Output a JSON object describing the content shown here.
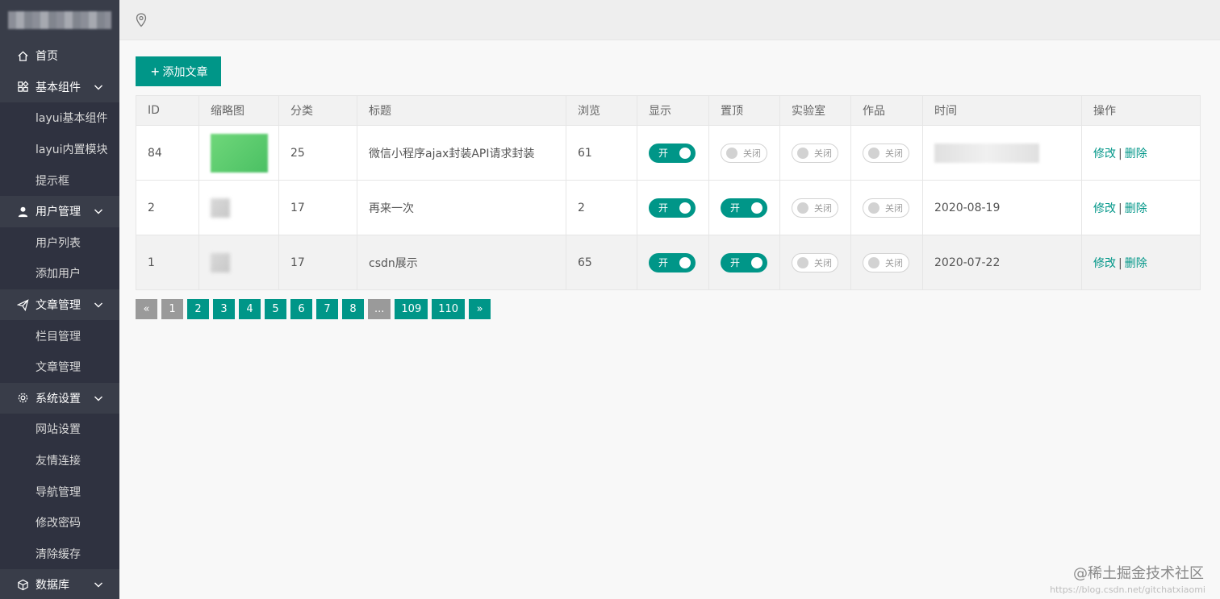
{
  "sidebar": {
    "items": [
      {
        "label": "首页",
        "icon": "home-icon",
        "sub": []
      },
      {
        "label": "基本组件",
        "icon": "grid-icon",
        "sub": [
          "layui基本组件",
          "layui内置模块",
          "提示框"
        ]
      },
      {
        "label": "用户管理",
        "icon": "user-icon",
        "sub": [
          "用户列表",
          "添加用户"
        ]
      },
      {
        "label": "文章管理",
        "icon": "send-icon",
        "sub": [
          "栏目管理",
          "文章管理"
        ]
      },
      {
        "label": "系统设置",
        "icon": "gear-icon",
        "sub": [
          "网站设置",
          "友情连接",
          "导航管理",
          "修改密码",
          "清除缓存"
        ]
      },
      {
        "label": "数据库",
        "icon": "cube-icon",
        "sub": []
      }
    ]
  },
  "header": {
    "location_icon": "location-pin-icon"
  },
  "toolbar": {
    "add_label": "添加文章"
  },
  "table": {
    "headers": [
      "ID",
      "缩略图",
      "分类",
      "标题",
      "浏览",
      "显示",
      "置顶",
      "实验室",
      "作品",
      "时间",
      "操作"
    ],
    "rows": [
      {
        "id": "84",
        "category": "25",
        "title": "微信小程序ajax封装API请求封装",
        "views": "61",
        "show": true,
        "top": false,
        "lab": false,
        "work": false,
        "time": ""
      },
      {
        "id": "2",
        "category": "17",
        "title": "再来一次",
        "views": "2",
        "show": true,
        "top": true,
        "lab": false,
        "work": false,
        "time": "2020-08-19"
      },
      {
        "id": "1",
        "category": "17",
        "title": "csdn展示",
        "views": "65",
        "show": true,
        "top": true,
        "lab": false,
        "work": false,
        "time": "2020-07-22"
      }
    ],
    "switch_on_label": "开",
    "switch_off_label": "关闭",
    "edit_label": "修改",
    "delete_label": "删除",
    "sep": "|"
  },
  "pagination": [
    "«",
    "1",
    "2",
    "3",
    "4",
    "5",
    "6",
    "7",
    "8",
    "...",
    "109",
    "110",
    "»"
  ],
  "watermark": "@稀土掘金技术社区",
  "watermark_url": "https://blog.csdn.net/gitchatxiaomi",
  "colors": {
    "sidebar": "#393d49",
    "submenu": "#2f3240",
    "accent": "#009688",
    "pager_gray": "#9a9a9a"
  }
}
